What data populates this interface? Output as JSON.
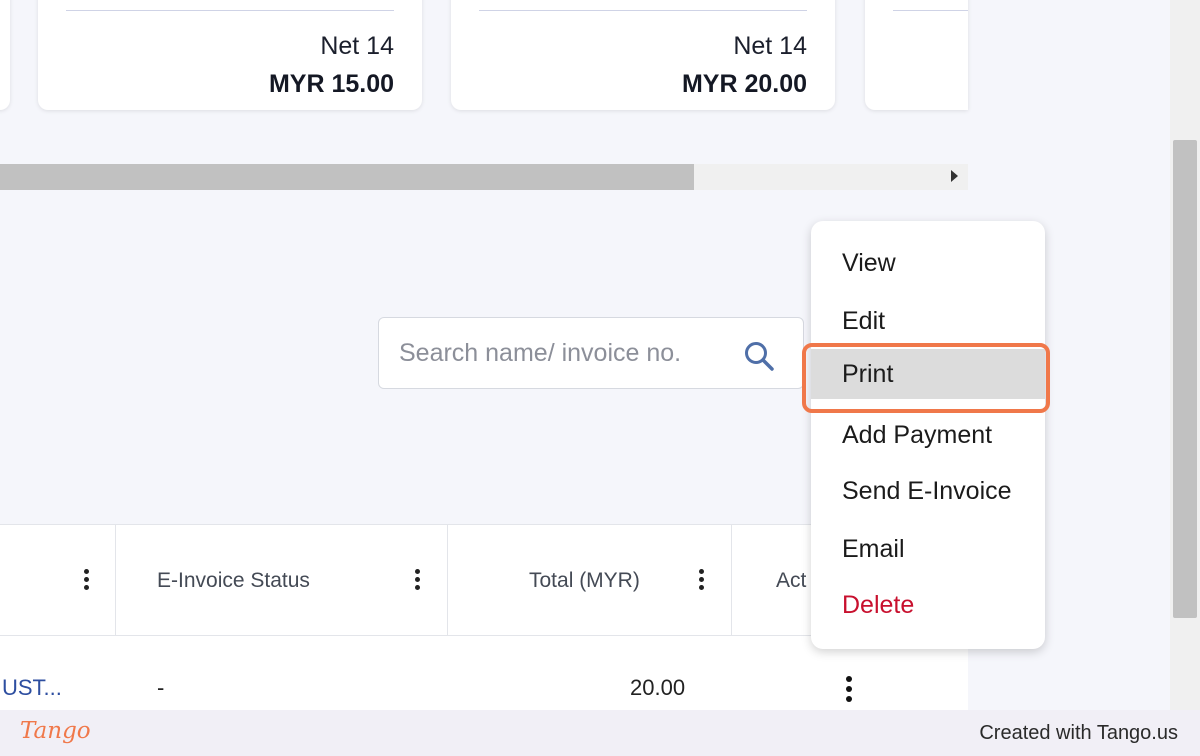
{
  "cards": [
    {
      "term": "Net 14",
      "amount": "MYR 15.00"
    },
    {
      "term": "Net 14",
      "amount": "MYR 20.00"
    }
  ],
  "search": {
    "placeholder": "Search name/ invoice no."
  },
  "table": {
    "headers": [
      "E-Invoice Status",
      "Total (MYR)",
      "Act"
    ],
    "row": {
      "customer": "UST...",
      "einvoice_status": "-",
      "total": "20.00"
    }
  },
  "menu": {
    "items": [
      "View",
      "Edit",
      "Print",
      "Add Payment",
      "Send E-Invoice",
      "Email",
      "Delete"
    ],
    "active": "Print"
  },
  "footer": {
    "logo": "Tango",
    "credit": "Created with Tango.us"
  },
  "colors": {
    "highlight": "#f0784a",
    "delete": "#c8102e",
    "link": "#2d4ea0"
  }
}
